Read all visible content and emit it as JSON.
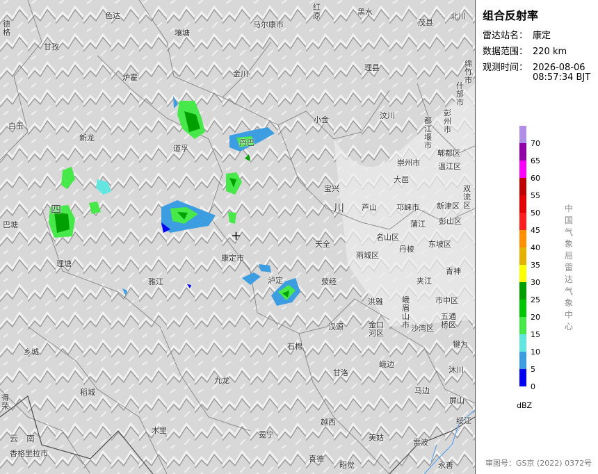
{
  "panel": {
    "title": "组合反射率",
    "station_label": "雷达站名：",
    "station_value": "康定",
    "range_label": "数据范围：",
    "range_value": "220 km",
    "time_label": "观测时间：",
    "time_date": "2026-08-06",
    "time_clock": "08:57:34 BJT",
    "legend_unit": "dBZ",
    "org_vertical": "中国气象局雷达气象中心",
    "approval": "审图号：GS京 (2022) 0372号"
  },
  "legend": [
    {
      "label": "70",
      "color": "#b18fe6"
    },
    {
      "label": "65",
      "color": "#9400a8"
    },
    {
      "label": "60",
      "color": "#ff00ff"
    },
    {
      "label": "55",
      "color": "#c00000"
    },
    {
      "label": "50",
      "color": "#e70000"
    },
    {
      "label": "45",
      "color": "#ff1d1d"
    },
    {
      "label": "40",
      "color": "#ff9000"
    },
    {
      "label": "35",
      "color": "#e6b200"
    },
    {
      "label": "30",
      "color": "#ffff00"
    },
    {
      "label": "25",
      "color": "#00a000"
    },
    {
      "label": "20",
      "color": "#00c800"
    },
    {
      "label": "15",
      "color": "#46e84a"
    },
    {
      "label": "10",
      "color": "#63e6e0"
    },
    {
      "label": "5",
      "color": "#3c9de0"
    },
    {
      "label": "0",
      "color": "#0000f5"
    }
  ],
  "places": [
    {
      "name": "色达"
    },
    {
      "name": "红原"
    },
    {
      "name": "黑水"
    },
    {
      "name": "北川"
    },
    {
      "name": "德格"
    },
    {
      "name": "壤塘"
    },
    {
      "name": "马尔康市"
    },
    {
      "name": "茂县"
    },
    {
      "name": "甘孜"
    },
    {
      "name": "炉霍"
    },
    {
      "name": "金川"
    },
    {
      "name": "理县"
    },
    {
      "name": "绵竹市"
    },
    {
      "name": "什邡市"
    },
    {
      "name": "白玉"
    },
    {
      "name": "新龙"
    },
    {
      "name": "道孚"
    },
    {
      "name": "丹巴"
    },
    {
      "name": "小金"
    },
    {
      "name": "汶川"
    },
    {
      "name": "彭州市"
    },
    {
      "name": "都江堰市"
    },
    {
      "name": "郫都区"
    },
    {
      "name": "崇州市"
    },
    {
      "name": "温江区"
    },
    {
      "name": "大邑"
    },
    {
      "name": "宝兴"
    },
    {
      "name": "芦山"
    },
    {
      "name": "邛崃市"
    },
    {
      "name": "新津区"
    },
    {
      "name": "双流区"
    },
    {
      "name": "巴塘"
    },
    {
      "name": "四"
    },
    {
      "name": "川"
    },
    {
      "name": "蒲江"
    },
    {
      "name": "彭山区"
    },
    {
      "name": "名山区"
    },
    {
      "name": "丹棱"
    },
    {
      "name": "东坡区"
    },
    {
      "name": "理塘"
    },
    {
      "name": "康定市"
    },
    {
      "name": "天全"
    },
    {
      "name": "雨城区"
    },
    {
      "name": "青神"
    },
    {
      "name": "雅江"
    },
    {
      "name": "泸定"
    },
    {
      "name": "荥经"
    },
    {
      "name": "洪雅"
    },
    {
      "name": "夹江"
    },
    {
      "name": "峨眉山市"
    },
    {
      "name": "市中区"
    },
    {
      "name": "五通桥区"
    },
    {
      "name": "沙湾区"
    },
    {
      "name": "汉源"
    },
    {
      "name": "金口河区"
    },
    {
      "name": "犍为"
    },
    {
      "name": "乡城"
    },
    {
      "name": "石棉"
    },
    {
      "name": "峨边"
    },
    {
      "name": "沐川"
    },
    {
      "name": "九龙"
    },
    {
      "name": "甘洛"
    },
    {
      "name": "马边"
    },
    {
      "name": "稻城"
    },
    {
      "name": "屏山"
    },
    {
      "name": "得荣"
    },
    {
      "name": "越西"
    },
    {
      "name": "绥江"
    },
    {
      "name": "木里"
    },
    {
      "name": "冕宁"
    },
    {
      "name": "美姑"
    },
    {
      "name": "雷波"
    },
    {
      "name": "云南"
    },
    {
      "name": "香格里拉市"
    },
    {
      "name": "喜德"
    },
    {
      "name": "昭觉"
    },
    {
      "name": "永善"
    }
  ]
}
